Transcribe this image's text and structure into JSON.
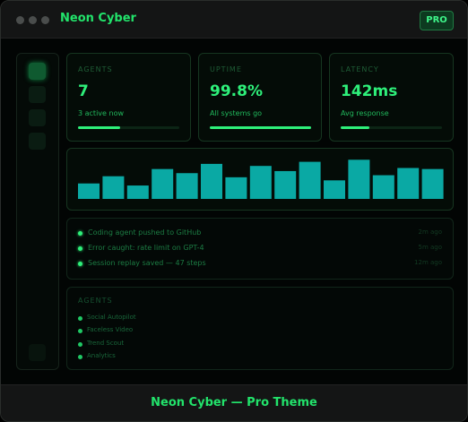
{
  "window": {
    "title": "Neon Cyber",
    "badge": "PRO"
  },
  "sidebar": {
    "items": [
      {
        "name": "active"
      },
      {
        "name": "item"
      },
      {
        "name": "item"
      },
      {
        "name": "item"
      },
      {
        "name": "settings"
      }
    ]
  },
  "stats": [
    {
      "label": "AGENTS",
      "value": "7",
      "sub": "3 active now",
      "progress": 0.42
    },
    {
      "label": "UPTIME",
      "value": "99.8%",
      "sub": "All systems go",
      "progress": 0.998
    },
    {
      "label": "LATENCY",
      "value": "142ms",
      "sub": "Avg response",
      "progress": 0.28
    }
  ],
  "chart_data": {
    "type": "bar",
    "values": [
      15,
      22,
      13,
      29,
      25,
      34,
      21,
      32,
      27,
      36,
      18,
      38,
      23,
      30,
      29
    ],
    "ylim": [
      0,
      40
    ]
  },
  "activity": [
    {
      "text": "Coding agent pushed to GitHub",
      "time": "2m ago"
    },
    {
      "text": "Error caught: rate limit on GPT-4",
      "time": "5m ago"
    },
    {
      "text": "Session replay saved — 47 steps",
      "time": "12m ago"
    }
  ],
  "agents": {
    "title": "AGENTS",
    "items": [
      "Social Autopilot",
      "Faceless Video",
      "Trend Scout",
      "Analytics"
    ]
  },
  "footer": {
    "text": "Neon Cyber — Pro Theme"
  },
  "colors": {
    "accent": "#2ef07a",
    "bar": "#0aa9a4",
    "background": "#050706"
  }
}
